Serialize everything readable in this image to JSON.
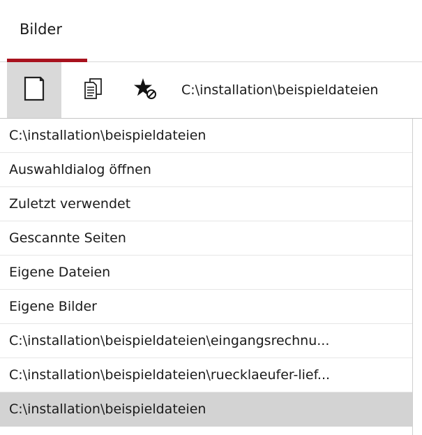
{
  "header": {
    "tab_label": "Bilder",
    "accent_color": "#a8121e"
  },
  "toolbar": {
    "buttons": [
      {
        "icon": "document-icon",
        "active": true
      },
      {
        "icon": "copy-document-icon",
        "active": false
      },
      {
        "icon": "favorite-remove-icon",
        "active": false
      }
    ],
    "path": "C:\\installation\\beispieldateien"
  },
  "list": {
    "items": [
      {
        "label": "C:\\installation\\beispieldateien",
        "selected": false
      },
      {
        "label": "Auswahldialog öffnen",
        "selected": false
      },
      {
        "label": "Zuletzt verwendet",
        "selected": false
      },
      {
        "label": "Gescannte Seiten",
        "selected": false
      },
      {
        "label": "Eigene Dateien",
        "selected": false
      },
      {
        "label": "Eigene Bilder",
        "selected": false
      },
      {
        "label": "C:\\installation\\beispieldateien\\eingangsrechnu...",
        "selected": false
      },
      {
        "label": "C:\\installation\\beispieldateien\\ruecklaeufer-lief...",
        "selected": false
      },
      {
        "label": "C:\\installation\\beispieldateien",
        "selected": true
      }
    ]
  }
}
